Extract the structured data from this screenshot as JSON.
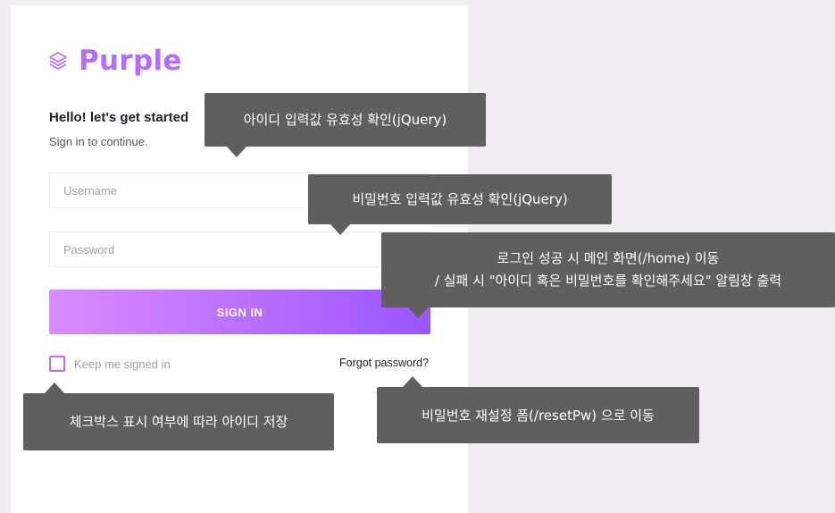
{
  "brand": {
    "name": "Purple",
    "color": "#b66dff",
    "icon": "layers-icon"
  },
  "login": {
    "heading": "Hello! let's get started",
    "subheading": "Sign in to continue.",
    "username_placeholder": "Username",
    "password_placeholder": "Password",
    "signin_label": "SIGN IN",
    "keep_signed_in_label": "Keep me signed in",
    "forgot_label": "Forgot password?"
  },
  "tooltips": {
    "username_validation": "아이디 입력값 유효성 확인(jQuery)",
    "password_validation": "비밀번호 입력값 유효성 확인(jQuery)",
    "signin_success": "로그인 성공 시 메인 화면(/home) 이동",
    "signin_failure": "/ 실패 시 \"아이디 혹은 비밀번호를 확인해주세요\" 알림창 출력",
    "remember_id": "체크박스 표시 여부에 따라 아이디 저장",
    "reset_password": "비밀번호 재설정 폼(/resetPw) 으로 이동"
  },
  "colors": {
    "accent": "#b66dff",
    "gradient_start": "#da8cff",
    "gradient_end": "#9a55ff",
    "tooltip_bg": "#5f5f5f",
    "page_bg": "#f2edf3"
  }
}
